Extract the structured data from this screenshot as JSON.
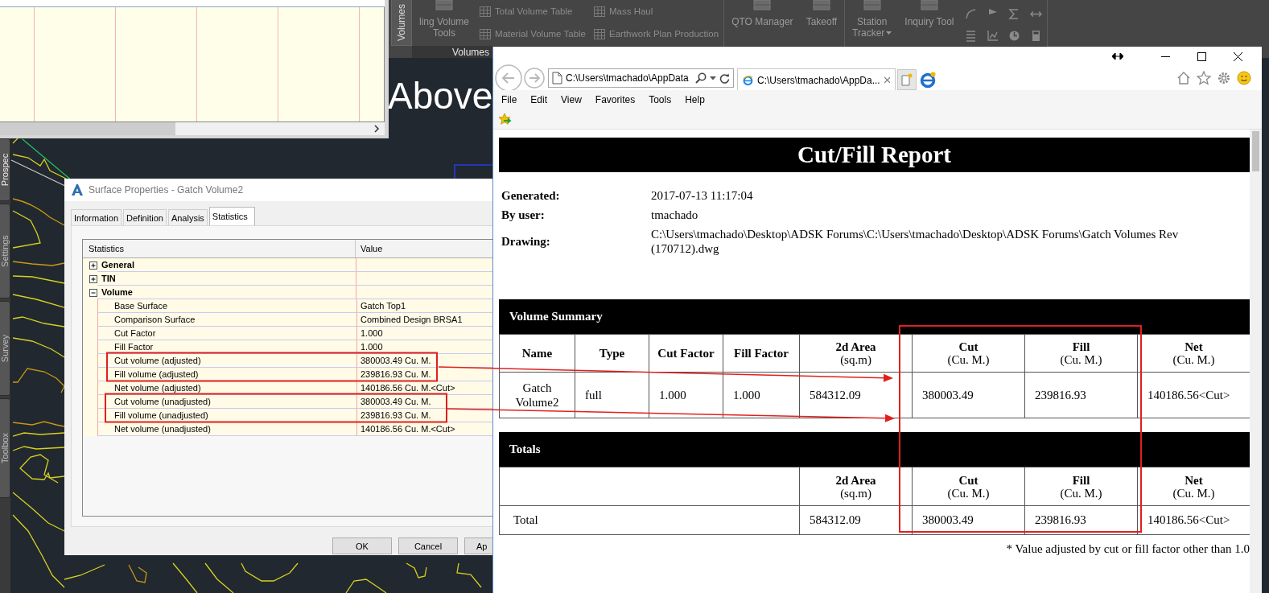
{
  "ribbon": {
    "side_tab": "Volumes",
    "panels": [
      {
        "label": "Volumes",
        "items": [
          {
            "kind": "large",
            "lines": [
              "ling Volume",
              "Tools"
            ],
            "dropdown": false
          },
          {
            "kind": "small",
            "lines": [
              "Total Volume Table"
            ]
          },
          {
            "kind": "small",
            "lines": [
              "Material Volume Table"
            ]
          },
          {
            "kind": "small",
            "lines": [
              "Mass Haul"
            ]
          },
          {
            "kind": "small",
            "lines": [
              "Earthwork Plan Production"
            ]
          }
        ]
      },
      {
        "items": [
          {
            "kind": "large",
            "lines": [
              "QTO Manager"
            ],
            "dropdown": false
          },
          {
            "kind": "large",
            "lines": [
              "Takeoff"
            ],
            "dropdown": false
          }
        ]
      },
      {
        "items": [
          {
            "kind": "large",
            "lines": [
              "Station",
              "Tracker"
            ],
            "dropdown": true
          },
          {
            "kind": "large",
            "lines": [
              "Inquiry Tool"
            ],
            "dropdown": false
          },
          {
            "kind": "icons"
          }
        ]
      }
    ]
  },
  "canvas": {
    "text": "Above"
  },
  "palette_tabs": [
    "Prospec",
    "Settings",
    "Survey",
    "Toolbox"
  ],
  "dialog": {
    "title": "Surface Properties - Gatch Volume2",
    "tabs": [
      {
        "label": "Information",
        "selected": false
      },
      {
        "label": "Definition",
        "selected": false
      },
      {
        "label": "Analysis",
        "selected": false
      },
      {
        "label": "Statistics",
        "selected": true
      }
    ],
    "columns": [
      "Statistics",
      "Value"
    ],
    "groups": [
      {
        "name": "General",
        "expanded": false
      },
      {
        "name": "TIN",
        "expanded": false
      },
      {
        "name": "Volume",
        "expanded": true,
        "rows": [
          {
            "name": "Base Surface",
            "value": "Gatch Top1"
          },
          {
            "name": "Comparison Surface",
            "value": "Combined Design BRSA1"
          },
          {
            "name": "Cut Factor",
            "value": "1.000"
          },
          {
            "name": "Fill Factor",
            "value": "1.000"
          },
          {
            "name": "Cut volume (adjusted)",
            "value": "380003.49 Cu. M."
          },
          {
            "name": "Fill volume (adjusted)",
            "value": "239816.93 Cu. M."
          },
          {
            "name": "Net volume (adjusted)",
            "value": "140186.56 Cu. M.<Cut>"
          },
          {
            "name": "Cut volume (unadjusted)",
            "value": "380003.49 Cu. M."
          },
          {
            "name": "Fill volume (unadjusted)",
            "value": "239816.93 Cu. M."
          },
          {
            "name": "Net volume (unadjusted)",
            "value": "140186.56 Cu. M.<Cut>"
          }
        ]
      }
    ],
    "buttons": [
      "OK",
      "Cancel",
      "Ap"
    ]
  },
  "browser": {
    "address": "C:\\Users\\tmachado\\AppData",
    "tabs": [
      {
        "title": "C:\\Users\\tmachado\\AppDa...",
        "selected": true
      }
    ],
    "menu": [
      "File",
      "Edit",
      "View",
      "Favorites",
      "Tools",
      "Help"
    ],
    "report": {
      "title": "Cut/Fill Report",
      "info": [
        {
          "label": "Generated:",
          "value": "2017-07-13 11:17:04"
        },
        {
          "label": "By user:",
          "value": "tmachado"
        },
        {
          "label": "Drawing:",
          "value": "C:\\Users\\tmachado\\Desktop\\ADSK Forums\\C:\\Users\\tmachado\\Desktop\\ADSK Forums\\Gatch Volumes Rev (170712).dwg"
        }
      ],
      "summary": {
        "heading": "Volume Summary",
        "columns": [
          {
            "label": "Name"
          },
          {
            "label": "Type"
          },
          {
            "label": "Cut Factor"
          },
          {
            "label": "Fill Factor"
          },
          {
            "label": "2d Area",
            "unit": "(sq.m)"
          },
          {
            "label": "Cut",
            "unit": "(Cu. M.)"
          },
          {
            "label": "Fill",
            "unit": "(Cu. M.)"
          },
          {
            "label": "Net",
            "unit": "(Cu. M.)"
          }
        ],
        "rows": [
          [
            "Gatch Volume2",
            "full",
            "1.000",
            "1.000",
            "584312.09",
            "380003.49",
            "239816.93",
            "140186.56<Cut>"
          ]
        ]
      },
      "totals": {
        "heading": "Totals",
        "columns": [
          {
            "label": "2d Area",
            "unit": "(sq.m)"
          },
          {
            "label": "Cut",
            "unit": "(Cu. M.)"
          },
          {
            "label": "Fill",
            "unit": "(Cu. M.)"
          },
          {
            "label": "Net",
            "unit": "(Cu. M.)"
          }
        ],
        "rows": [
          {
            "label": "Total",
            "values": [
              "584312.09",
              "380003.49",
              "239816.93",
              "140186.56<Cut>"
            ]
          }
        ]
      },
      "footnote": "* Value adjusted by cut or fill factor other than 1.0"
    }
  }
}
